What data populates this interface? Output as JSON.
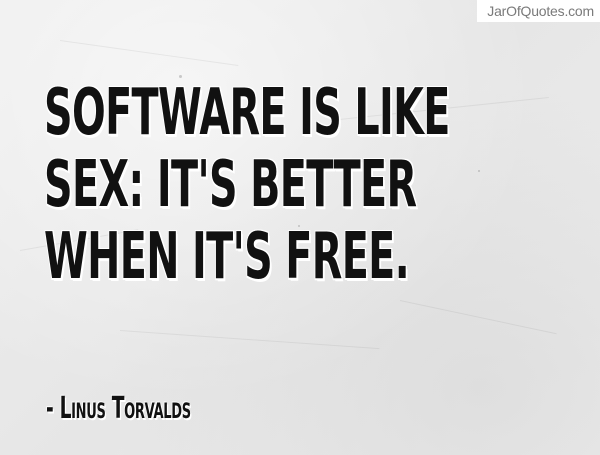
{
  "watermark": {
    "text": "JarOfQuotes.com"
  },
  "quote": {
    "lines": [
      "Software is like",
      "sex: it's better",
      "when it's free."
    ]
  },
  "author": {
    "text": "- Linus Torvalds"
  },
  "colors": {
    "background": "#ececec",
    "text": "#111111",
    "text_outline": "#ffffff",
    "watermark_text": "#7a7a7a",
    "watermark_bg": "#ffffff"
  }
}
